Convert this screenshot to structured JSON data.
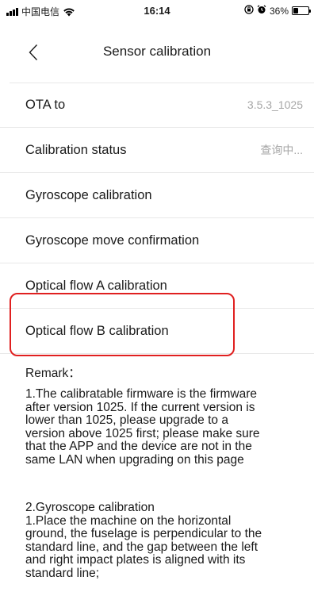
{
  "status_bar": {
    "carrier": "中国电信",
    "time": "16:14",
    "battery": "36%",
    "battery_level": 0.36
  },
  "nav": {
    "title": "Sensor calibration"
  },
  "rows": [
    {
      "label": "OTA to",
      "value": "3.5.3_1025"
    },
    {
      "label": "Calibration status",
      "value": "查询中..."
    },
    {
      "label": "Gyroscope calibration",
      "value": ""
    },
    {
      "label": "Gyroscope move confirmation",
      "value": ""
    },
    {
      "label": "Optical flow A calibration",
      "value": ""
    },
    {
      "label": "Optical flow B calibration",
      "value": ""
    }
  ],
  "remark": {
    "title": "Remark：",
    "paragraph_1": "1.The calibratable firmware is the firmware\nafter version 1025. If the current version is\nlower than 1025, please upgrade to a\nversion above 1025 first; please make sure\nthat the APP and the device are not in the\nsame LAN when upgrading on this page",
    "paragraph_2": "2.Gyroscope calibration\n1.Place the machine on the horizontal\nground, the fuselage is perpendicular to the\nstandard line, and the gap between the left\nand right impact plates is aligned with its\nstandard line;"
  },
  "colors": {
    "highlight": "#e02020",
    "divider": "#e8e8e8",
    "secondary_text": "#a6a6a6"
  }
}
